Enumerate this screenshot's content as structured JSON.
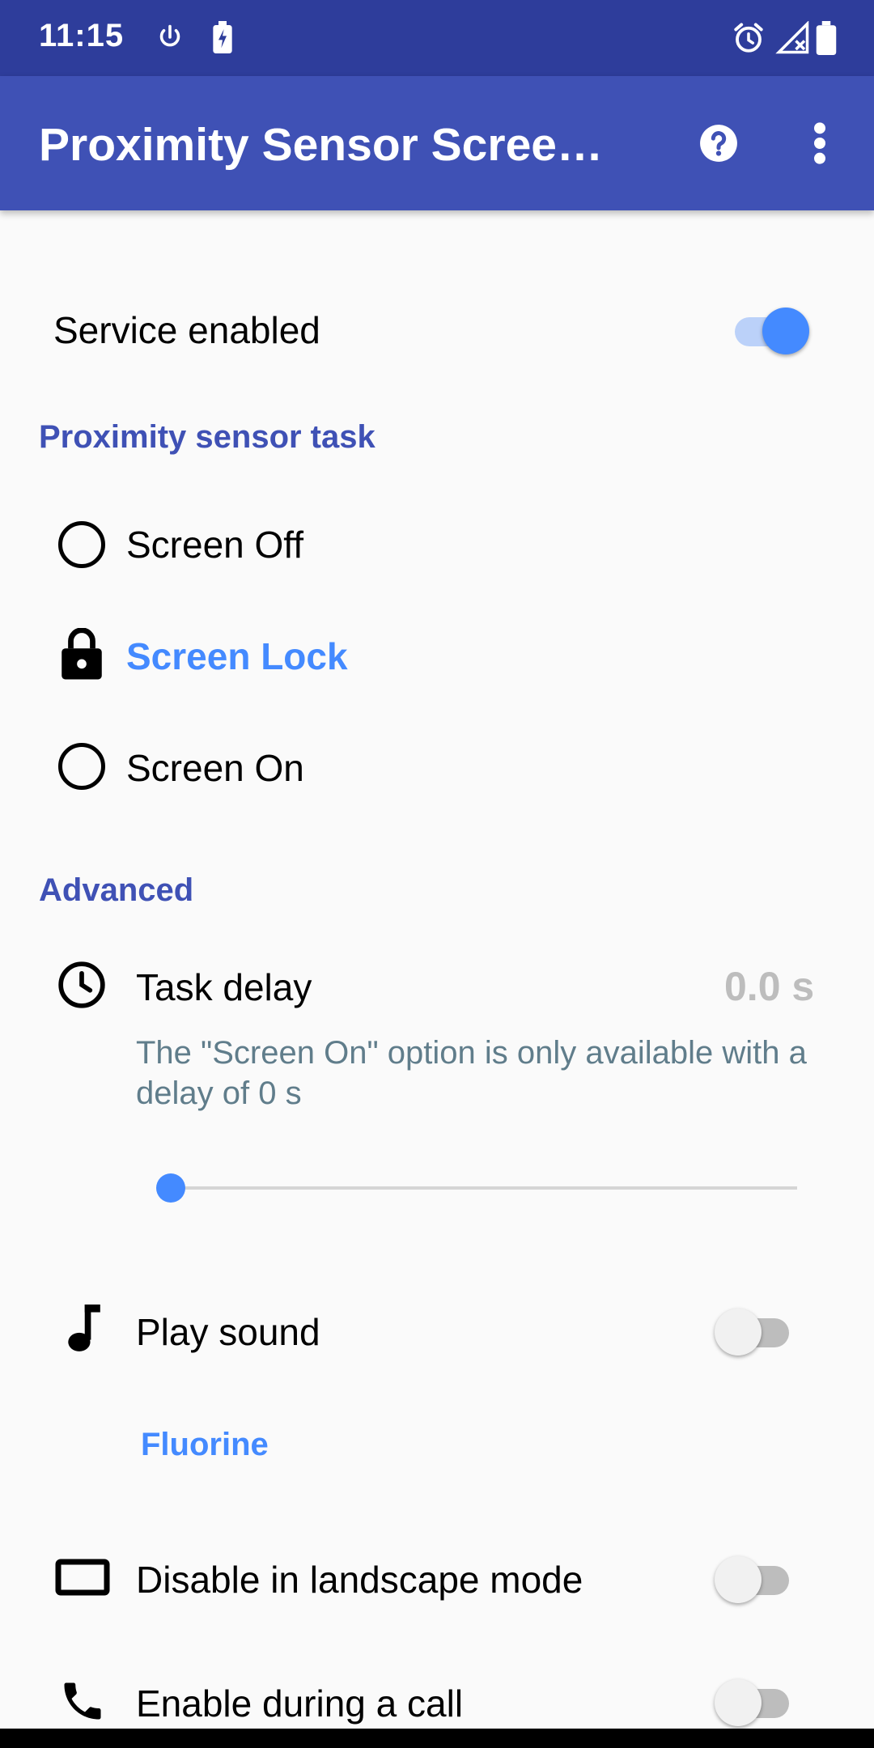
{
  "status_bar": {
    "time": "11:15",
    "left_icons": [
      "power-icon",
      "battery-saver-icon"
    ],
    "right_icons": [
      "alarm-icon",
      "signal-no-data-icon",
      "battery-icon"
    ]
  },
  "app_bar": {
    "title": "Proximity Sensor Screen…",
    "actions": [
      "help-icon",
      "overflow-menu-icon"
    ]
  },
  "service": {
    "label": "Service enabled",
    "enabled": true
  },
  "task_section": {
    "header": "Proximity sensor task",
    "options": [
      {
        "label": "Screen Off",
        "selected": false,
        "icon": "radio-unchecked-icon"
      },
      {
        "label": "Screen Lock",
        "selected": true,
        "icon": "lock-icon"
      },
      {
        "label": "Screen On",
        "selected": false,
        "icon": "radio-unchecked-icon"
      }
    ]
  },
  "advanced": {
    "header": "Advanced",
    "task_delay": {
      "label": "Task delay",
      "value": "0.0 s",
      "summary": "The \"Screen On\" option is only available with a delay of 0 s",
      "slider_fraction": 0.0
    },
    "play_sound": {
      "label": "Play sound",
      "enabled": false,
      "sound": "Fluorine"
    },
    "landscape": {
      "label": "Disable in landscape mode",
      "enabled": false
    },
    "call": {
      "label": "Enable during a call",
      "enabled": false
    }
  },
  "colors": {
    "status_bar": "#2E3D9B",
    "app_bar": "#3F51B5",
    "accent": "#448AFF",
    "section_header": "#3F51B5",
    "secondary_text": "#607D8B",
    "background": "#FAFAFA"
  }
}
